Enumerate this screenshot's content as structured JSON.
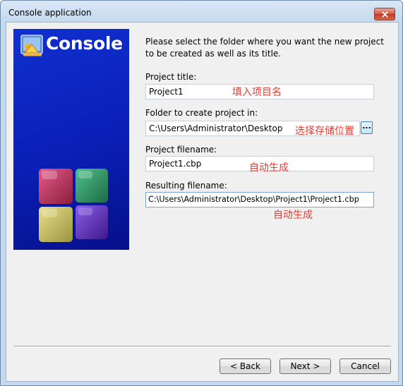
{
  "window": {
    "title": "Console application"
  },
  "banner": {
    "title": "Console",
    "logo_icon": "codeblocks-logo-icon",
    "art_icon": "colored-cubes-icon"
  },
  "intro": "Please select the folder where you want the new project to be created as well as its title.",
  "fields": {
    "project_title": {
      "label": "Project title:",
      "value": "Project1",
      "annotation": "填入项目名"
    },
    "folder": {
      "label": "Folder to create project in:",
      "value": "C:\\Users\\Administrator\\Desktop",
      "annotation": "选择存储位置",
      "browse_label": "..."
    },
    "project_filename": {
      "label": "Project filename:",
      "value": "Project1.cbp",
      "annotation": "自动生成"
    },
    "resulting_filename": {
      "label": "Resulting filename:",
      "value": "C:\\Users\\Administrator\\Desktop\\Project1\\Project1.cbp",
      "annotation": "自动生成"
    }
  },
  "buttons": {
    "back": "< Back",
    "next": "Next >",
    "cancel": "Cancel"
  },
  "colors": {
    "annotation": "#e53b32",
    "banner": "#0a1fb5",
    "close": "#c33a22"
  }
}
